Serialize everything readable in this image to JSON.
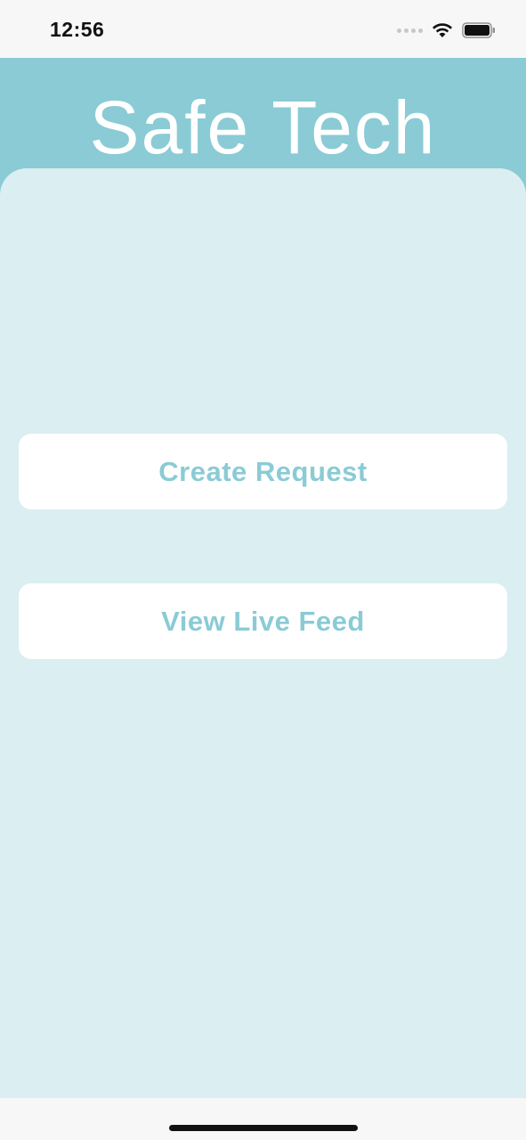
{
  "status_bar": {
    "time": "12:56"
  },
  "header": {
    "title": "Safe Tech"
  },
  "actions": {
    "create_request_label": "Create Request",
    "view_live_feed_label": "View Live Feed"
  },
  "colors": {
    "brand": "#8acbd5",
    "panel_background": "#dbeef2",
    "button_background": "#ffffff"
  },
  "icons": {
    "signal": "cellular-signal-icon",
    "wifi": "wifi-icon",
    "battery": "battery-icon"
  }
}
